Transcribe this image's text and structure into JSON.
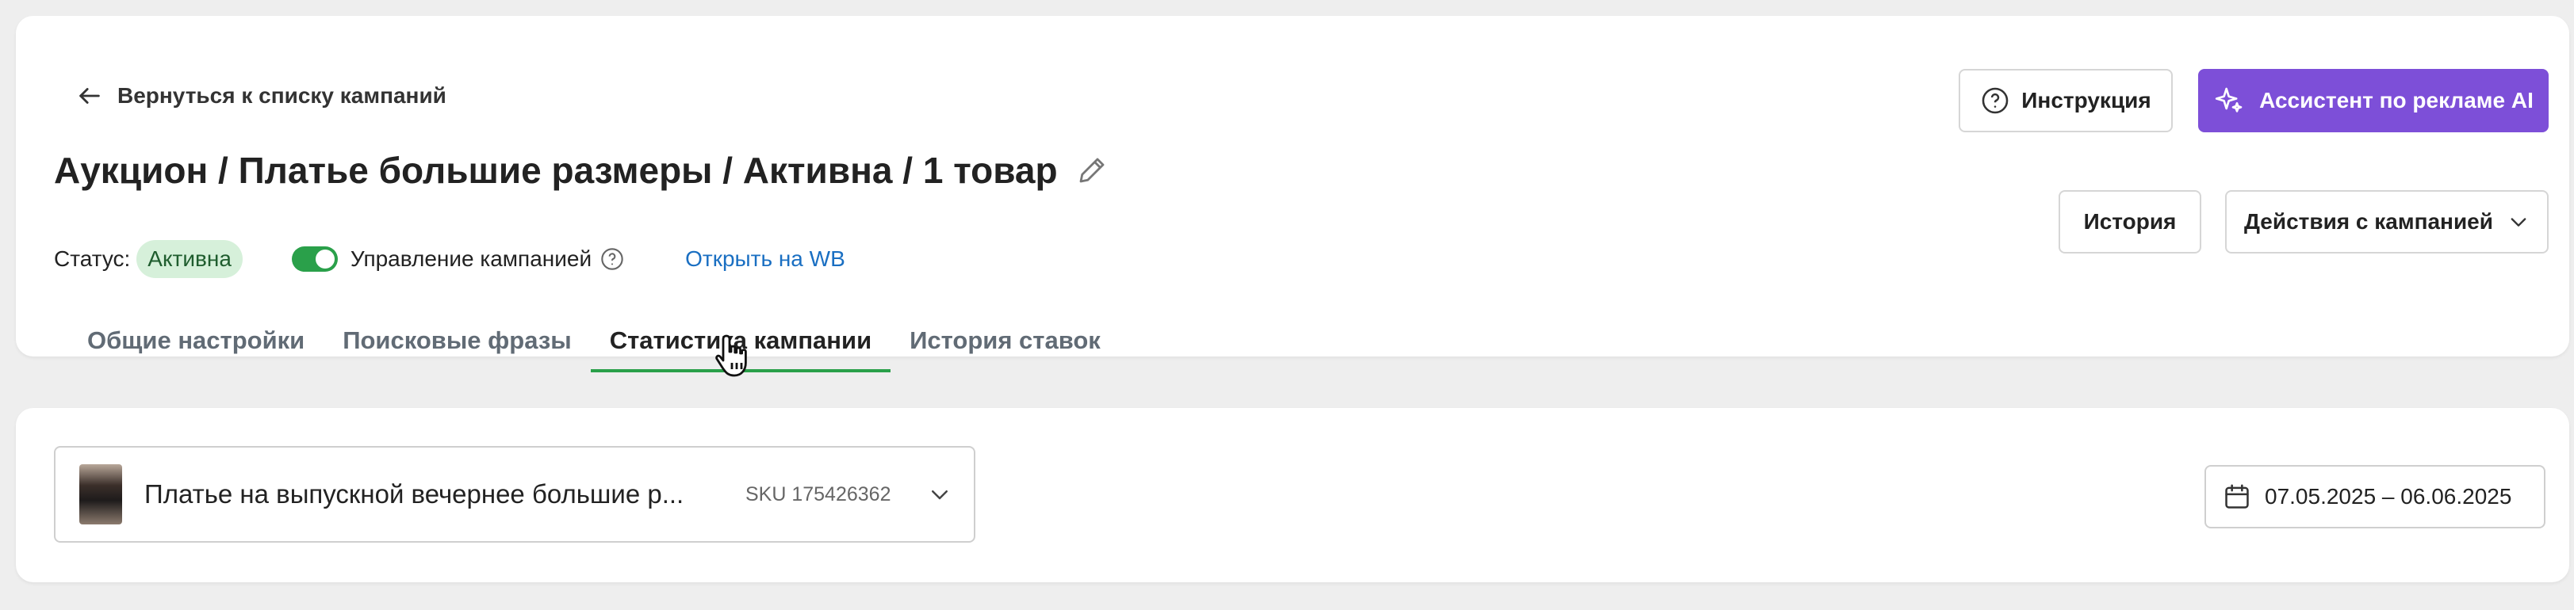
{
  "header": {
    "back_label": "Вернуться к списку кампаний",
    "title": "Аукцион / Платье большие размеры / Активна / 1 товар"
  },
  "status": {
    "label": "Статус:",
    "value": "Активна",
    "campaign_management_label": "Управление кампанией",
    "campaign_management_enabled": true,
    "open_wb_label": "Открыть на WB"
  },
  "tabs": [
    {
      "label": "Общие настройки",
      "active": false
    },
    {
      "label": "Поисковые фразы",
      "active": false
    },
    {
      "label": "Статистика кампании",
      "active": true
    },
    {
      "label": "История ставок",
      "active": false
    }
  ],
  "buttons": {
    "instruction": "Инструкция",
    "ai_assistant": "Ассистент по рекламе AI",
    "history": "История",
    "actions": "Действия с кампанией"
  },
  "product": {
    "name": "Платье на выпускной вечернее большие р...",
    "sku": "SKU 175426362"
  },
  "date_range": "07.05.2025 – 06.06.2025",
  "colors": {
    "accent_green": "#2aa04a",
    "ai_button_purple": "#7d4fd8",
    "link_blue": "#1a6fc2",
    "status_badge_bg": "#d6f0da"
  },
  "icons": {
    "back": "arrow-left-icon",
    "edit": "pencil-icon",
    "help": "question-circle-icon",
    "ai": "sparkle-icon",
    "dropdown": "chevron-down-icon",
    "calendar": "calendar-icon",
    "cursor": "hand-pointer-icon"
  }
}
